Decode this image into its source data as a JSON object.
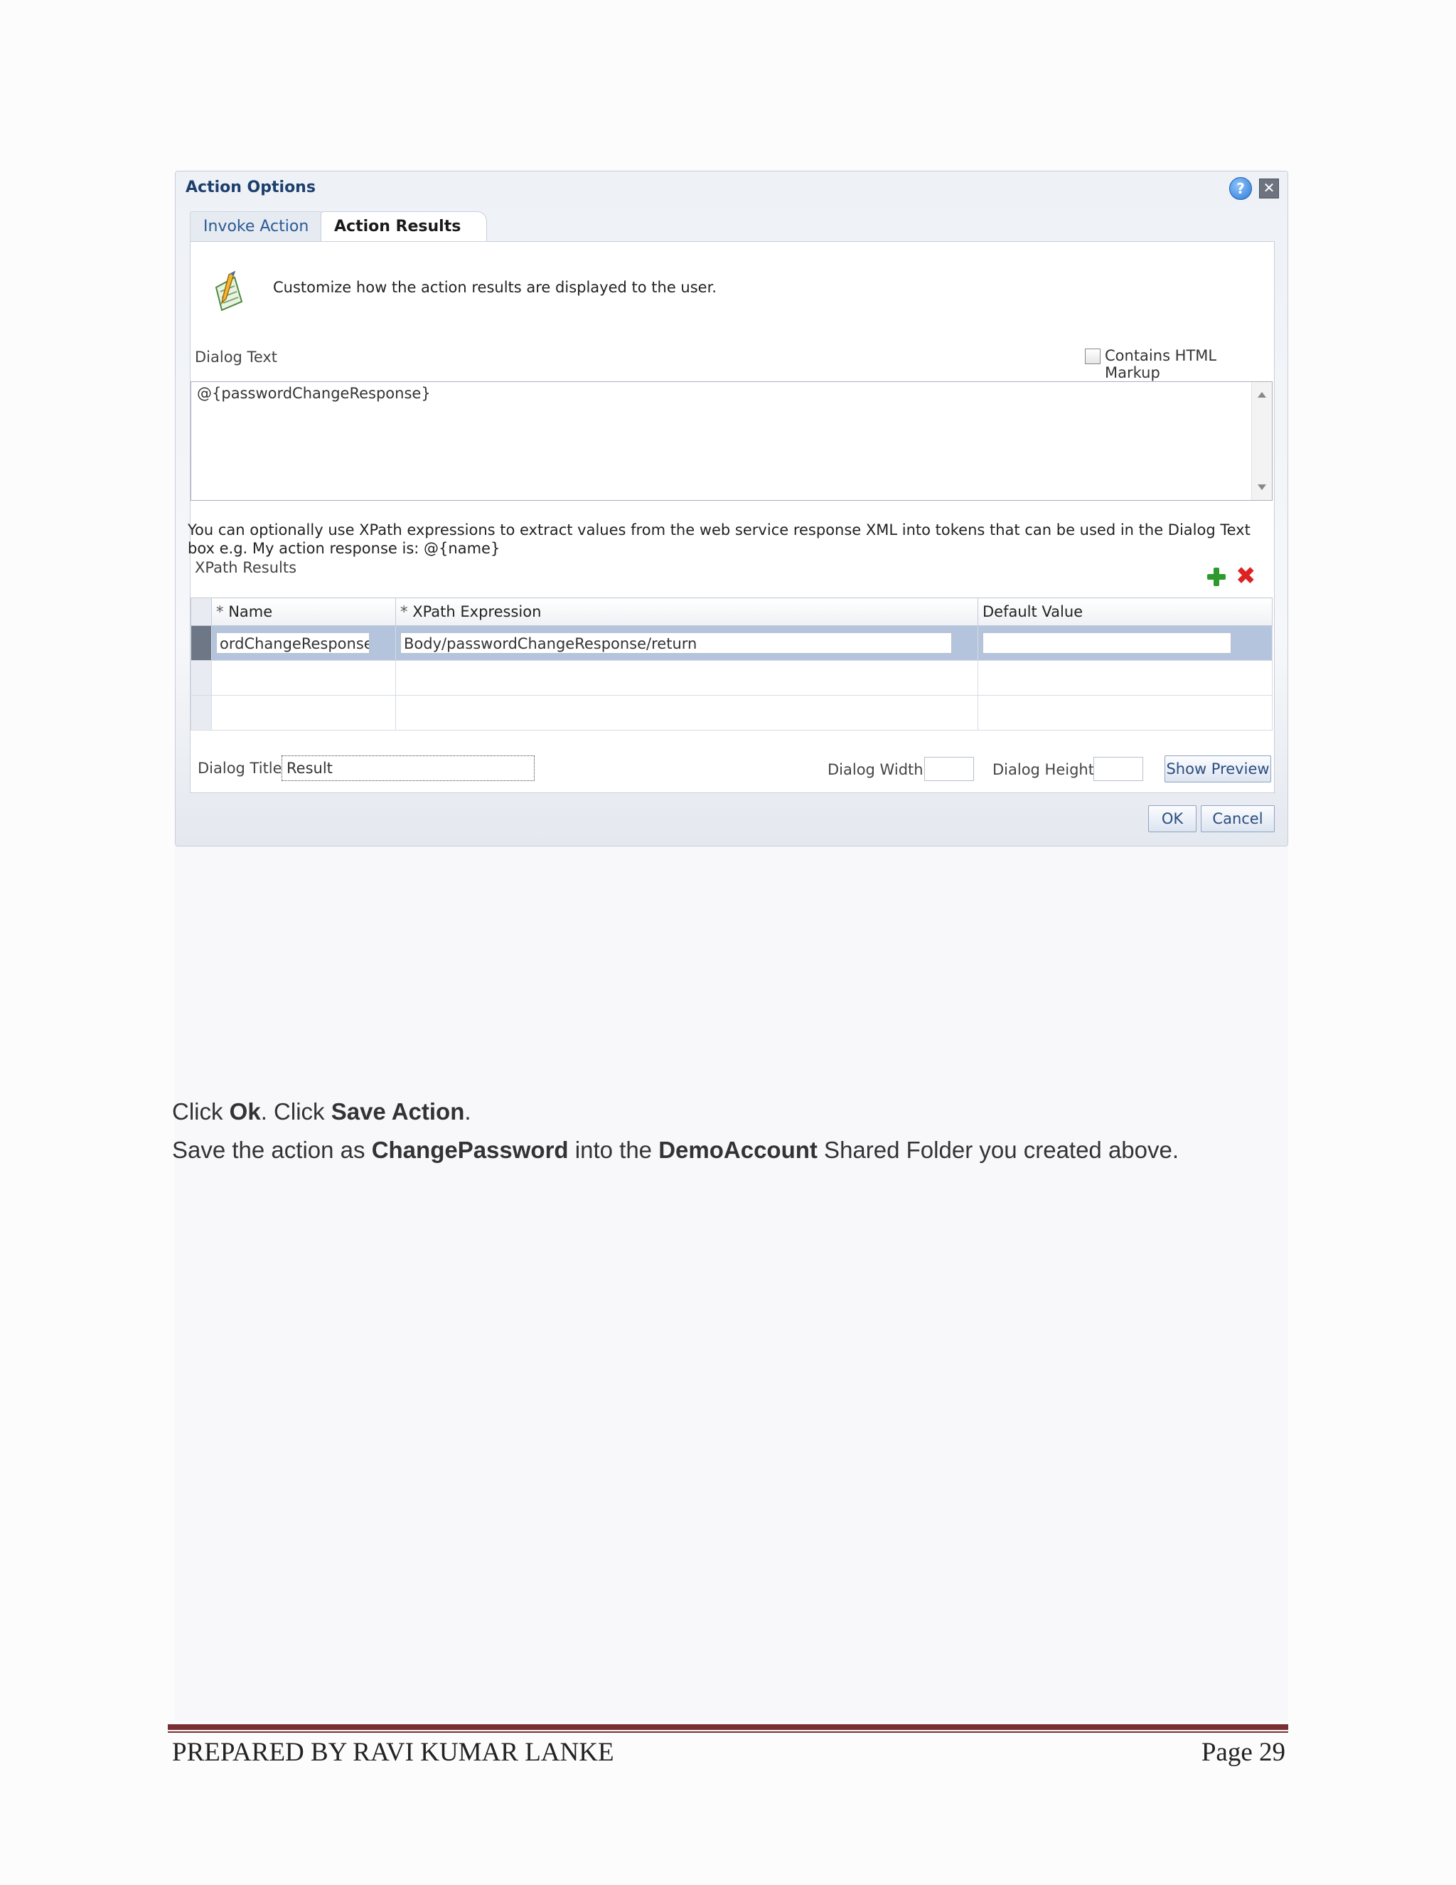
{
  "dialog": {
    "title": "Action Options",
    "help_glyph": "?",
    "close_glyph": "✕",
    "tabs": [
      {
        "label": "Invoke Action",
        "active": false
      },
      {
        "label": "Action Results",
        "active": true
      }
    ],
    "intro_text": "Customize how the action results are displayed to the user.",
    "dialog_text_label": "Dialog Text",
    "contains_html_label": "Contains HTML Markup",
    "contains_html_checked": false,
    "dialog_text_value": "@{passwordChangeResponse}",
    "info_text": "You can optionally use XPath expressions to extract values from the web service response XML into tokens that can be used in the Dialog Text box e.g. My action response is: @{name}",
    "xpath_results_label": "XPath Results",
    "table": {
      "headers": {
        "required_mark": "*",
        "name": "Name",
        "xpath": "XPath Expression",
        "default": "Default Value"
      },
      "rows": [
        {
          "name": "ordChangeResponse",
          "xpath": "Body/passwordChangeResponse/return",
          "default": ""
        }
      ]
    },
    "dialog_title_label": "Dialog Title",
    "dialog_title_value": "Result",
    "dialog_width_label": "Dialog Width",
    "dialog_height_label": "Dialog Height",
    "show_preview_label": "Show Preview",
    "ok_label": "OK",
    "cancel_label": "Cancel"
  },
  "doc": {
    "line1": {
      "t1": "Click ",
      "b1": "Ok",
      "t2": ". Click ",
      "b2": "Save Action",
      "t3": "."
    },
    "line2": {
      "t1": "Save the action as ",
      "b1": "ChangePassword",
      "t2": " into the ",
      "b2": "DemoAccount",
      "t3": " Shared Folder you created above."
    }
  },
  "footer": {
    "left": "PREPARED BY RAVI KUMAR LANKE",
    "right": "Page 29"
  },
  "colors": {
    "accent_rule": "#7a2f33",
    "selected_row": "#b5c4dd",
    "title_blue": "#1c3f6e"
  }
}
